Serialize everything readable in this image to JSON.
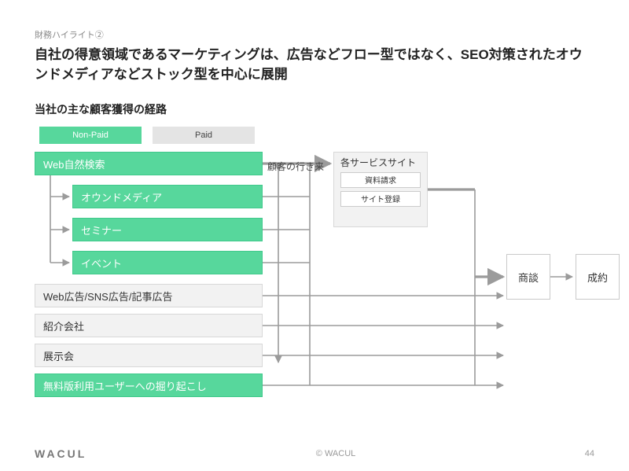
{
  "kicker": "財務ハイライト②",
  "title": "自社の得意領域であるマーケティングは、広告などフロー型ではなく、SEO対策されたオウンドメディアなどストック型を中心に展開",
  "subtitle": "当社の主な顧客獲得の経路",
  "legend": {
    "nonpaid": "Non-Paid",
    "paid": "Paid"
  },
  "channels": {
    "web_search": "Web自然検索",
    "owned_media": "オウンドメディア",
    "seminar": "セミナー",
    "event": "イベント",
    "ads": "Web広告/SNS広告/記事広告",
    "referral": "紹介会社",
    "expo": "展示会",
    "free_users": "無料版利用ユーザーへの掘り起こし"
  },
  "flow_label": "顧客の行き来",
  "service_box": {
    "header": "各サービスサイト",
    "doc": "資料請求",
    "reg": "サイト登録"
  },
  "funnel": {
    "shodan": "商談",
    "seiyaku": "成約"
  },
  "footer": {
    "logo": "WACUL",
    "copyright": "© WACUL",
    "page": "44"
  }
}
